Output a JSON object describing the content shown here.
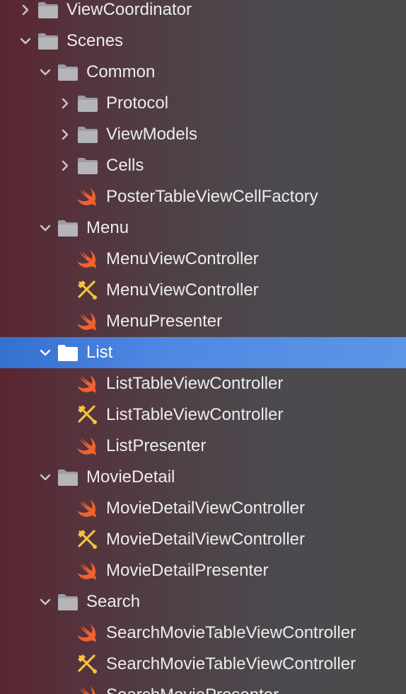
{
  "navigator": {
    "items": [
      {
        "label": "ViewCoordinator",
        "kind": "folder",
        "depth": 0,
        "expanded": false
      },
      {
        "label": "Scenes",
        "kind": "folder",
        "depth": 0,
        "expanded": true
      },
      {
        "label": "Common",
        "kind": "folder",
        "depth": 1,
        "expanded": true
      },
      {
        "label": "Protocol",
        "kind": "folder",
        "depth": 2,
        "expanded": false
      },
      {
        "label": "ViewModels",
        "kind": "folder",
        "depth": 2,
        "expanded": false
      },
      {
        "label": "Cells",
        "kind": "folder",
        "depth": 2,
        "expanded": false
      },
      {
        "label": "PosterTableViewCellFactory",
        "kind": "swift",
        "depth": 2
      },
      {
        "label": "Menu",
        "kind": "folder",
        "depth": 1,
        "expanded": true
      },
      {
        "label": "MenuViewController",
        "kind": "swift",
        "depth": 2
      },
      {
        "label": "MenuViewController",
        "kind": "xib",
        "depth": 2
      },
      {
        "label": "MenuPresenter",
        "kind": "swift",
        "depth": 2
      },
      {
        "label": "List",
        "kind": "folder",
        "depth": 1,
        "expanded": true,
        "selected": true
      },
      {
        "label": "ListTableViewController",
        "kind": "swift",
        "depth": 2
      },
      {
        "label": "ListTableViewController",
        "kind": "xib",
        "depth": 2
      },
      {
        "label": "ListPresenter",
        "kind": "swift",
        "depth": 2
      },
      {
        "label": "MovieDetail",
        "kind": "folder",
        "depth": 1,
        "expanded": true
      },
      {
        "label": "MovieDetailViewController",
        "kind": "swift",
        "depth": 2
      },
      {
        "label": "MovieDetailViewController",
        "kind": "xib",
        "depth": 2
      },
      {
        "label": "MovieDetailPresenter",
        "kind": "swift",
        "depth": 2
      },
      {
        "label": "Search",
        "kind": "folder",
        "depth": 1,
        "expanded": true
      },
      {
        "label": "SearchMovieTableViewController",
        "kind": "swift",
        "depth": 2
      },
      {
        "label": "SearchMovieTableViewController",
        "kind": "xib",
        "depth": 2
      },
      {
        "label": "SearchMoviePresenter",
        "kind": "swift",
        "depth": 2
      }
    ]
  },
  "icons": {
    "folder": "folder-icon",
    "swift": "swift-file-icon",
    "xib": "interface-builder-file-icon"
  },
  "colors": {
    "selection": "#4f88e3",
    "folder": "#a9a9ae",
    "swift": "#f0612f",
    "xib": "#f2c241"
  }
}
